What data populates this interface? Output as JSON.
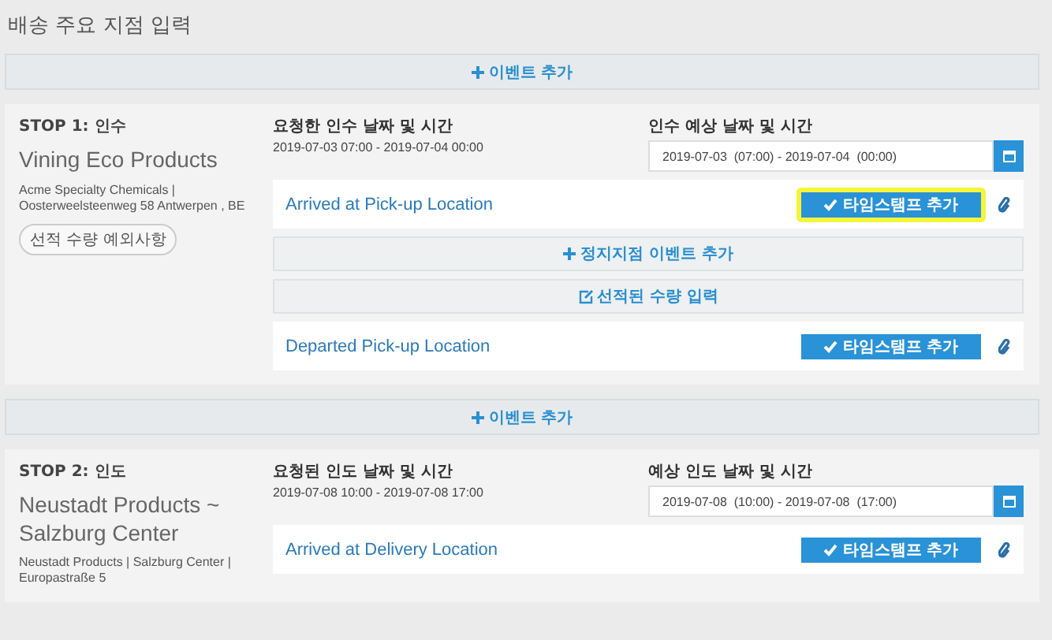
{
  "title": "배송 주요 지점 입력",
  "sections": [
    {
      "kind": "add_event",
      "label": "이벤트 추가"
    },
    {
      "kind": "stop",
      "stop_label": "STOP 1: 인수",
      "name": "Vining Eco Products",
      "address": "Acme Specialty Chemicals | Oosterweelsteenweg 58 Antwerpen , BE",
      "tag": "선적 수량 예외사항",
      "requested_label": "요청한 인수 날짜 및 시간",
      "requested_value": "2019-07-03 07:00 - 2019-07-04 00:00",
      "expected_label": "인수 예상 날짜 및 시간",
      "expected_value": "2019-07-03  (07:00) - 2019-07-04  (00:00)",
      "rows": [
        {
          "kind": "event",
          "label": "Arrived at Pick-up Location",
          "button": "타임스탬프 추가",
          "highlighted": true
        },
        {
          "kind": "add_action",
          "label": "정지지점 이벤트 추가"
        },
        {
          "kind": "edit_action",
          "label": "선적된 수량 입력"
        },
        {
          "kind": "event",
          "label": "Departed Pick-up Location",
          "button": "타임스탬프 추가",
          "highlighted": false
        }
      ]
    },
    {
      "kind": "add_event",
      "label": "이벤트 추가"
    },
    {
      "kind": "stop",
      "stop_label": "STOP 2: 인도",
      "name": "Neustadt Products ~ Salzburg Center",
      "address": "Neustadt Products | Salzburg Center | Europastraße 5",
      "requested_label": "요청된 인도 날짜 및 시간",
      "requested_value": "2019-07-08 10:00 - 2019-07-08 17:00",
      "expected_label": "예상 인도 날짜 및 시간",
      "expected_value": "2019-07-08  (10:00) - 2019-07-08  (17:00)",
      "rows": [
        {
          "kind": "event",
          "label": "Arrived at Delivery Location",
          "button": "타임스탬프 추가",
          "highlighted": false
        }
      ]
    }
  ]
}
